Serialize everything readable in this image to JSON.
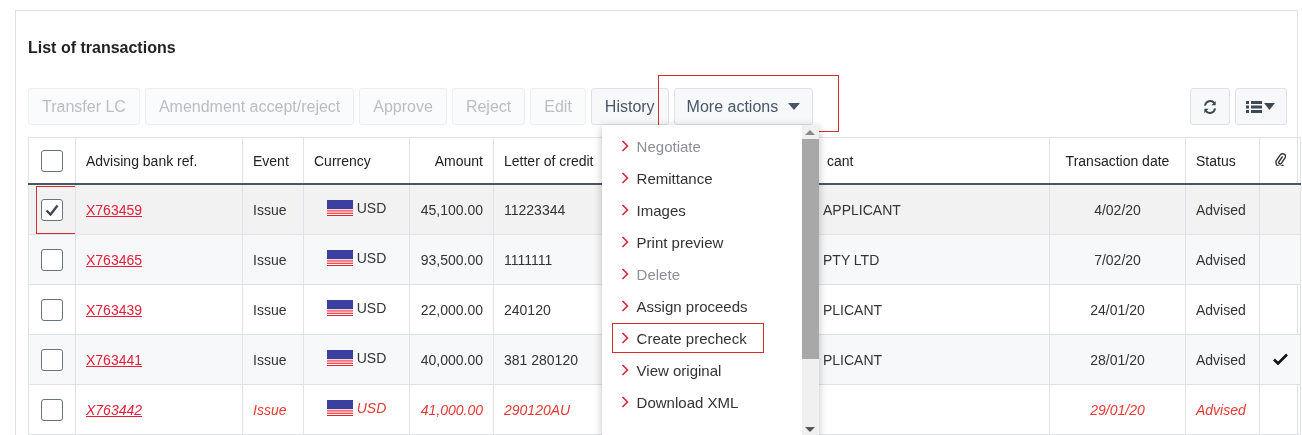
{
  "title": "List of transactions",
  "actions": [
    {
      "label": "Transfer LC",
      "disabled": true
    },
    {
      "label": "Amendment accept/reject",
      "disabled": true
    },
    {
      "label": "Approve",
      "disabled": true
    },
    {
      "label": "Reject",
      "disabled": true
    },
    {
      "label": "Edit",
      "disabled": true
    },
    {
      "label": "History",
      "disabled": false
    }
  ],
  "more_actions": {
    "label": "More actions",
    "annotated": true,
    "expanded": true
  },
  "menu": [
    {
      "label": "Negotiate",
      "disabled": true,
      "annotated": false
    },
    {
      "label": "Remittance",
      "disabled": false,
      "annotated": false
    },
    {
      "label": "Images",
      "disabled": false,
      "annotated": false
    },
    {
      "label": "Print preview",
      "disabled": false,
      "annotated": false
    },
    {
      "label": "Delete",
      "disabled": true,
      "annotated": false
    },
    {
      "label": "Assign proceeds",
      "disabled": false,
      "annotated": false
    },
    {
      "label": "Create precheck",
      "disabled": false,
      "annotated": true
    },
    {
      "label": "View original",
      "disabled": false,
      "annotated": false
    },
    {
      "label": "Download XML",
      "disabled": false,
      "annotated": false
    }
  ],
  "table": {
    "select_all": {
      "checked": false
    },
    "columns": [
      "Advising bank ref.",
      "Event",
      "Currency",
      "Amount",
      "Letter of credit",
      "cant",
      "Transaction date",
      "Status"
    ],
    "rows": [
      {
        "selected": true,
        "annotated": true,
        "alert": false,
        "ref": "X763459",
        "event": "Issue",
        "currency": "USD",
        "amount": "45,100.00",
        "lc": "11223344",
        "applicant": "APPLICANT",
        "date": "4/02/20",
        "status": "Advised",
        "attachment": false
      },
      {
        "selected": false,
        "annotated": false,
        "alert": false,
        "ref": "X763465",
        "event": "Issue",
        "currency": "USD",
        "amount": "93,500.00",
        "lc": "1111111",
        "applicant": "PTY LTD",
        "date": "7/02/20",
        "status": "Advised",
        "attachment": false
      },
      {
        "selected": false,
        "annotated": false,
        "alert": false,
        "ref": "X763439",
        "event": "Issue",
        "currency": "USD",
        "amount": "22,000.00",
        "lc": "240120",
        "applicant": "PLICANT",
        "date": "24/01/20",
        "status": "Advised",
        "attachment": false
      },
      {
        "selected": false,
        "annotated": false,
        "alert": false,
        "ref": "X763441",
        "event": "Issue",
        "currency": "USD",
        "amount": "40,000.00",
        "lc": "381 280120",
        "applicant": "PLICANT",
        "date": "28/01/20",
        "status": "Advised",
        "attachment": true
      },
      {
        "selected": false,
        "annotated": false,
        "alert": true,
        "ref": "X763442",
        "event": "Issue",
        "currency": "USD",
        "amount": "41,000.00",
        "lc": "290120AU",
        "applicant": "",
        "date": "29/01/20",
        "status": "Advised",
        "attachment": false
      }
    ]
  }
}
